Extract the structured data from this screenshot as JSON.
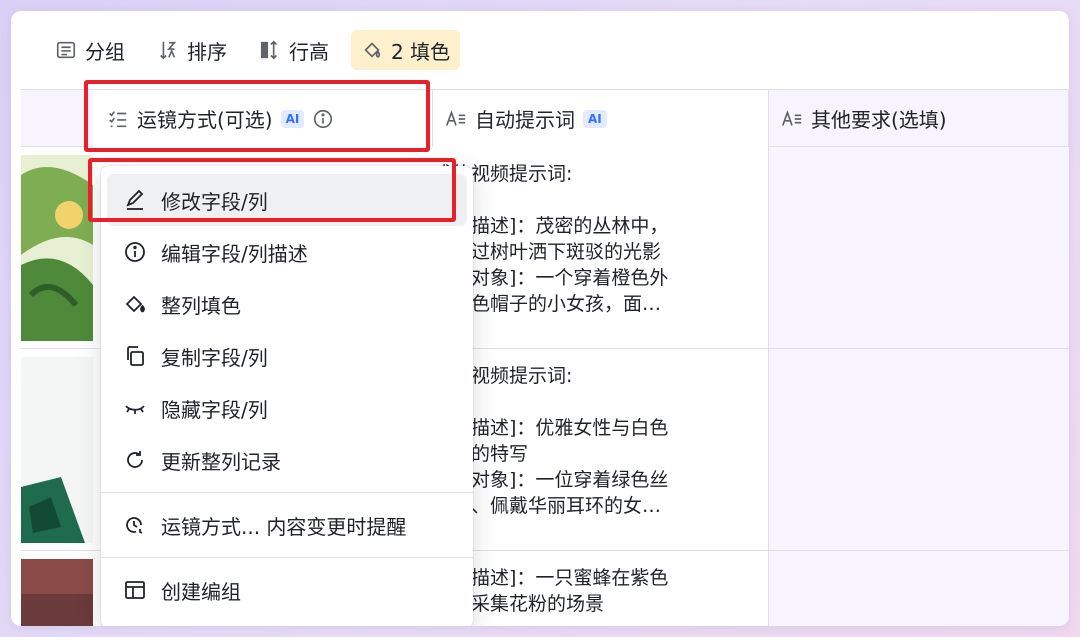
{
  "toolbar": {
    "group_label": "分组",
    "sort_label": "排序",
    "row_height_label": "行高",
    "fill_label": "2 填色"
  },
  "columns": {
    "col1": {
      "label": "运镜方式(可选)",
      "badge": "AI"
    },
    "col2": {
      "label": "自动提示词",
      "badge": "AI"
    },
    "col3": {
      "label": "其他要求(选填)"
    }
  },
  "rows": [
    {
      "prompt": [
        "成的视频提示词:",
        "",
        "场景描述]：茂密的丛林中，",
        "光透过树叶洒下斑驳的光影",
        "主体对象]：一个穿着橙色外",
        "和白色帽子的小女孩，面…"
      ]
    },
    {
      "prompt": [
        "成的视频提示词:",
        "",
        "场景描述]：优雅女性与白色",
        "合花的特写",
        "主体对象]：一位穿着绿色丝",
        "礼服、佩戴华丽耳环的女…"
      ]
    },
    {
      "prompt": [
        "场景描述]：一只蜜蜂在紫色",
        "朵上采集花粉的场景"
      ]
    }
  ],
  "menu": {
    "items": [
      {
        "label": "修改字段/列",
        "icon": "edit-icon"
      },
      {
        "label": "编辑字段/列描述",
        "icon": "info-icon"
      },
      {
        "label": "整列填色",
        "icon": "paint-bucket-icon"
      },
      {
        "label": "复制字段/列",
        "icon": "copy-icon"
      },
      {
        "label": "隐藏字段/列",
        "icon": "eye-closed-icon"
      },
      {
        "label": "更新整列记录",
        "icon": "refresh-icon"
      },
      {
        "label": "运镜方式... 内容变更时提醒",
        "icon": "clock-alert-icon"
      },
      {
        "label": "创建编组",
        "icon": "layout-group-icon"
      }
    ]
  },
  "colors": {
    "accent_yellow": "#fdf0cc",
    "highlight_red": "#e8202a",
    "ai_blue": "#3370ff",
    "column_tint": "#f7f3ff"
  }
}
